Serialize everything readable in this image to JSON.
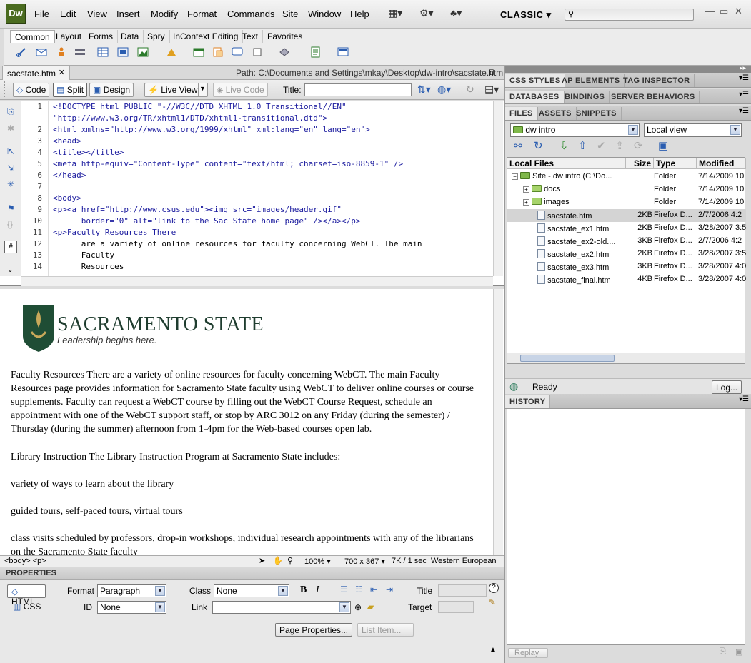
{
  "app": {
    "logo": "Dw",
    "workspace": "CLASSIC"
  },
  "menu": [
    "File",
    "Edit",
    "View",
    "Insert",
    "Modify",
    "Format",
    "Commands",
    "Site",
    "Window",
    "Help"
  ],
  "insert_tabs": [
    "Common",
    "Layout",
    "Forms",
    "Data",
    "Spry",
    "InContext Editing",
    "Text",
    "Favorites"
  ],
  "document": {
    "tab": "sacstate.htm",
    "path": "Path:  C:\\Documents and Settings\\mkay\\Desktop\\dw-intro\\sacstate.htm"
  },
  "toolbar": {
    "code": "Code",
    "split": "Split",
    "design": "Design",
    "live_view": "Live View",
    "live_code": "Live Code",
    "title_label": "Title:",
    "title_value": ""
  },
  "code_lines": [
    {
      "n": "1",
      "t": "<!DOCTYPE html PUBLIC \"-//W3C//DTD XHTML 1.0 Transitional//EN\""
    },
    {
      "n": "",
      "t": "\"http://www.w3.org/TR/xhtml1/DTD/xhtml1-transitional.dtd\">"
    },
    {
      "n": "2",
      "t": "<html xmlns=\"http://www.w3.org/1999/xhtml\" xml:lang=\"en\" lang=\"en\">"
    },
    {
      "n": "3",
      "t": "<head>"
    },
    {
      "n": "4",
      "t": "<title></title>"
    },
    {
      "n": "5",
      "t": "<meta http-equiv=\"Content-Type\" content=\"text/html; charset=iso-8859-1\" />"
    },
    {
      "n": "6",
      "t": "</head>"
    },
    {
      "n": "7",
      "t": ""
    },
    {
      "n": "8",
      "t": "<body>"
    },
    {
      "n": "9",
      "t": "<p><a href=\"http://www.csus.edu\"><img src=\"images/header.gif\""
    },
    {
      "n": "10",
      "t": "      border=\"0\" alt=\"link to the Sac State home page\" /></a></p>"
    },
    {
      "n": "11",
      "t": "<p>Faculty Resources There"
    },
    {
      "n": "12",
      "t": "      are a variety of online resources for faculty concerning WebCT. The main"
    },
    {
      "n": "13",
      "t": "      Faculty"
    },
    {
      "n": "14",
      "t": "      Resources"
    }
  ],
  "design": {
    "logo_title": "SACRAMENTO STATE",
    "logo_tagline": "Leadership begins here.",
    "paragraphs": [
      "Faculty Resources There are a variety of online resources for faculty concerning WebCT. The main Faculty Resources page provides information for Sacramento State faculty using WebCT to deliver online courses or course supplements. Faculty can request a WebCT course by filling out the WebCT Course Request, schedule an appointment with one of the WebCT support staff, or stop by ARC 3012 on any Friday (during the semester) / Thursday (during the summer) afternoon from 1-4pm for the Web-based courses open lab.",
      "Library Instruction The Library Instruction Program at Sacramento State includes:",
      "variety of ways to learn about the library",
      "guided tours, self-paced tours, virtual tours",
      "class visits scheduled by professors, drop-in workshops, individual research appointments with any of the librarians on the Sacramento State faculty"
    ]
  },
  "status": {
    "tags": "<body> <p>",
    "zoom": "100%",
    "size": "700 x 367",
    "download": "7K / 1 sec",
    "encoding": "Western European"
  },
  "properties": {
    "header": "PROPERTIES",
    "html_btn": "HTML",
    "css_btn": "CSS",
    "format_label": "Format",
    "format_value": "Paragraph",
    "class_label": "Class",
    "class_value": "None",
    "id_label": "ID",
    "id_value": "None",
    "link_label": "Link",
    "title_label": "Title",
    "target_label": "Target",
    "page_props": "Page Properties...",
    "list_item": "List Item..."
  },
  "panels": {
    "row1": [
      "CSS STYLES",
      "AP ELEMENTS",
      "TAG INSPECTOR"
    ],
    "row2": [
      "DATABASES",
      "BINDINGS",
      "SERVER BEHAVIORS"
    ],
    "row3": [
      "FILES",
      "ASSETS",
      "SNIPPETS"
    ],
    "site": "dw intro",
    "view": "Local view",
    "columns": [
      "Local Files",
      "Size",
      "Type",
      "Modified"
    ],
    "files": [
      {
        "name": "Site - dw intro (C:\\Do...",
        "size": "",
        "type": "Folder",
        "mod": "7/14/2009 10",
        "kind": "site"
      },
      {
        "name": "docs",
        "size": "",
        "type": "Folder",
        "mod": "7/14/2009 10",
        "kind": "folder"
      },
      {
        "name": "images",
        "size": "",
        "type": "Folder",
        "mod": "7/14/2009 10",
        "kind": "folder"
      },
      {
        "name": "sacstate.htm",
        "size": "2KB",
        "type": "Firefox D...",
        "mod": "2/7/2006 4:2",
        "kind": "file"
      },
      {
        "name": "sacstate_ex1.htm",
        "size": "2KB",
        "type": "Firefox D...",
        "mod": "3/28/2007 3:5",
        "kind": "file"
      },
      {
        "name": "sacstate_ex2-old....",
        "size": "3KB",
        "type": "Firefox D...",
        "mod": "2/7/2006 4:2",
        "kind": "file"
      },
      {
        "name": "sacstate_ex2.htm",
        "size": "2KB",
        "type": "Firefox D...",
        "mod": "3/28/2007 3:5",
        "kind": "file"
      },
      {
        "name": "sacstate_ex3.htm",
        "size": "3KB",
        "type": "Firefox D...",
        "mod": "3/28/2007 4:0",
        "kind": "file"
      },
      {
        "name": "sacstate_final.htm",
        "size": "4KB",
        "type": "Firefox D...",
        "mod": "3/28/2007 4:0",
        "kind": "file"
      }
    ],
    "ready": "Ready",
    "log": "Log...",
    "history": "HISTORY",
    "replay": "Replay"
  }
}
